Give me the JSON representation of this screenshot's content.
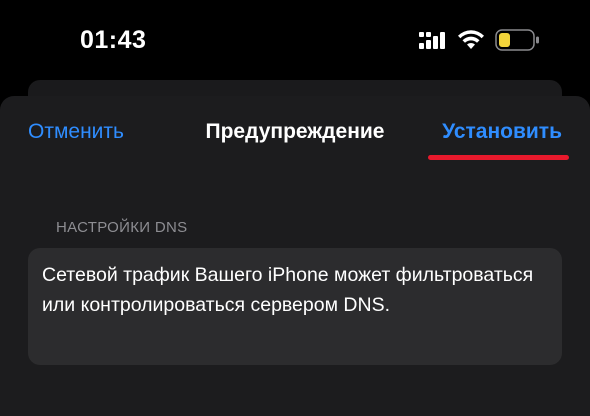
{
  "status_bar": {
    "time": "01:43",
    "icons": [
      "signal-icon",
      "wifi-icon",
      "battery-icon"
    ],
    "battery_color": "#f2d43a"
  },
  "nav": {
    "cancel_label": "Отменить",
    "title": "Предупреждение",
    "install_label": "Установить"
  },
  "section": {
    "header": "НАСТРОЙКИ DNS",
    "body": "Сетевой трафик Вашего iPhone может фильтроваться или контролироваться сервером DNS."
  },
  "colors": {
    "accent": "#2f8dff",
    "highlight_underline": "#e8192c",
    "sheet_background": "#1c1c1e",
    "card_background": "#2c2c2e"
  }
}
